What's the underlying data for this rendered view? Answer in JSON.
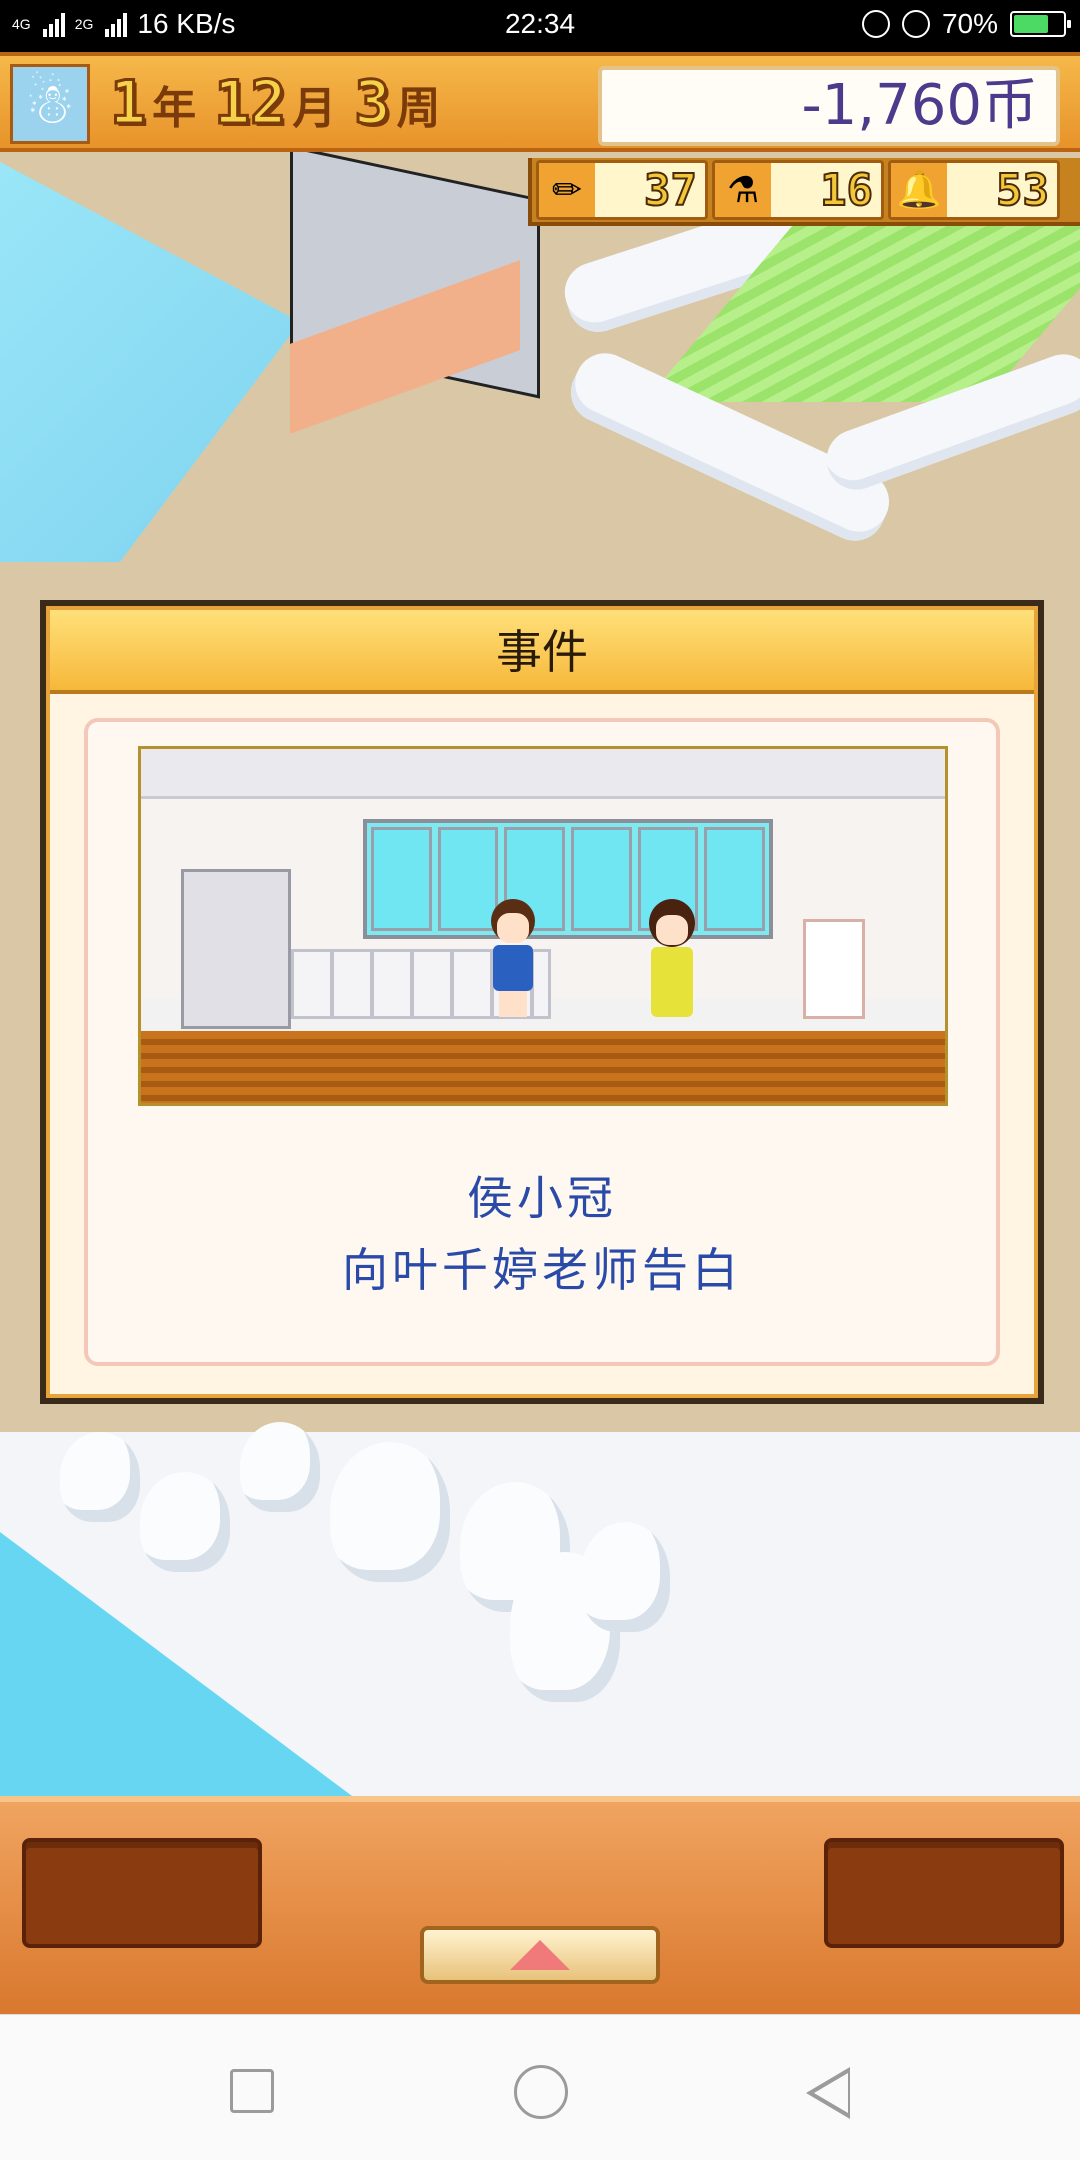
{
  "status_bar": {
    "network_left": "4G",
    "network_right": "2G",
    "speed": "16 KB/s",
    "time": "22:34",
    "battery": "70%",
    "battery_level": 0.7
  },
  "hud": {
    "avatar_icon": "snowman-icon",
    "year": "1",
    "year_unit": "年",
    "month": "12",
    "month_unit": "月",
    "week": "3",
    "week_unit": "周",
    "money": "-1,760",
    "currency": "币"
  },
  "stats": [
    {
      "icon": "pencil-icon",
      "glyph": "✏",
      "value": "37"
    },
    {
      "icon": "flask-icon",
      "glyph": "⚗",
      "value": "16"
    },
    {
      "icon": "bell-icon",
      "glyph": "🔔",
      "value": "53"
    }
  ],
  "dialog": {
    "title": "事件",
    "line1": "侯小冠",
    "line2": "向叶千婷老师告白"
  },
  "colors": {
    "hud_orange": "#f6b84a",
    "dialog_text": "#2a4aa8",
    "panel": "#d9782e"
  }
}
